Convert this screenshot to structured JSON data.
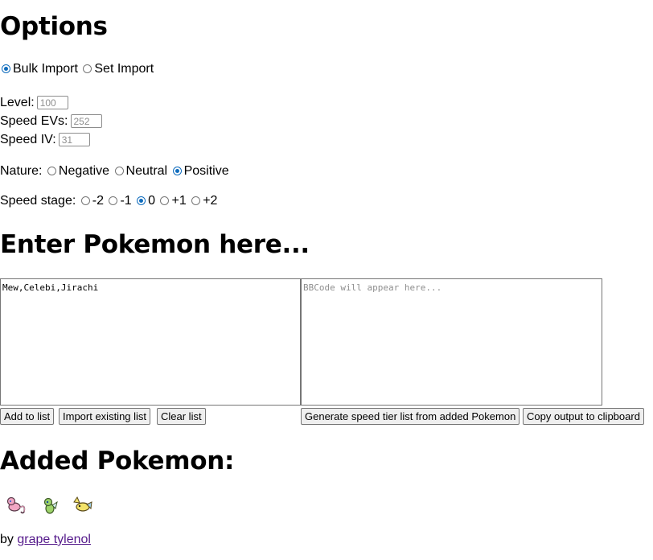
{
  "options": {
    "title": "Options",
    "import_mode": {
      "options": [
        {
          "label": "Bulk Import",
          "checked": true
        },
        {
          "label": "Set Import",
          "checked": false
        }
      ]
    },
    "level": {
      "label": "Level:",
      "placeholder": "100"
    },
    "speed_evs": {
      "label": "Speed EVs:",
      "placeholder": "252"
    },
    "speed_iv": {
      "label": "Speed IV:",
      "placeholder": "31"
    },
    "nature": {
      "label": "Nature:",
      "options": [
        {
          "label": "Negative",
          "checked": false
        },
        {
          "label": "Neutral",
          "checked": false
        },
        {
          "label": "Positive",
          "checked": true
        }
      ]
    },
    "speed_stage": {
      "label": "Speed stage:",
      "options": [
        {
          "label": "-2",
          "checked": false
        },
        {
          "label": "-1",
          "checked": false
        },
        {
          "label": "0",
          "checked": true
        },
        {
          "label": "+1",
          "checked": false
        },
        {
          "label": "+2",
          "checked": false
        }
      ]
    }
  },
  "enter": {
    "title": "Enter Pokemon here...",
    "input_value": "Mew,Celebi,Jirachi",
    "output_placeholder": "BBCode will appear here...",
    "buttons": {
      "add": "Add to list",
      "import_existing": "Import existing list",
      "clear": "Clear list",
      "generate": "Generate speed tier list from added Pokemon",
      "copy": "Copy output to clipboard"
    }
  },
  "added": {
    "title": "Added Pokemon:",
    "sprites": [
      {
        "icon": "mew-sprite-icon",
        "color": "#f2a7c4"
      },
      {
        "icon": "celebi-sprite-icon",
        "color": "#9ed36a"
      },
      {
        "icon": "jirachi-sprite-icon",
        "color": "#f3e36a"
      }
    ]
  },
  "footer": {
    "by": "by",
    "author": "grape tylenol"
  }
}
